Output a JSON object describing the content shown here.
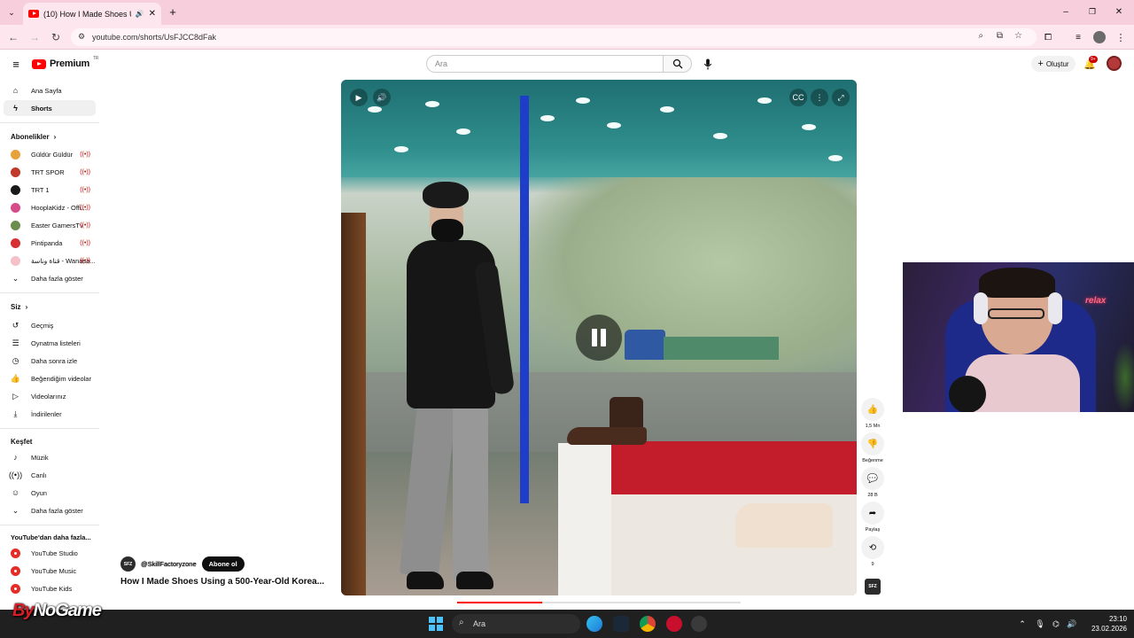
{
  "browser": {
    "tab_title": "(10) How I Made Shoes Usi",
    "url": "youtube.com/shorts/UsFJCC8dFak"
  },
  "header": {
    "logo_text": "Premium",
    "logo_region": "TR",
    "search_placeholder": "Ara",
    "create_label": "Oluştur",
    "notification_count": "9+"
  },
  "sidebar": {
    "main": [
      {
        "label": "Ana Sayfa",
        "icon": "home-icon"
      },
      {
        "label": "Shorts",
        "icon": "shorts-icon",
        "active": true
      }
    ],
    "subscriptions_header": "Abonelikler",
    "subscriptions": [
      {
        "label": "Güldür Güldür",
        "color": "#e8a23b",
        "live": true
      },
      {
        "label": "TRT SPOR",
        "color": "#c0392b",
        "live": true
      },
      {
        "label": "TRT 1",
        "color": "#1a1a1a",
        "live": true
      },
      {
        "label": "HooplaKidz - Offi...",
        "color": "#d64b8a",
        "live": true
      },
      {
        "label": "Easter GamersTv",
        "color": "#6b8e4e",
        "live": true
      },
      {
        "label": "Pintipanda",
        "color": "#d63031",
        "live": true
      },
      {
        "label": "قناة وناسة - Wanasa...",
        "color": "#f5c0c8",
        "live": true
      }
    ],
    "subscriptions_more": "Daha fazla göster",
    "you_header": "Siz",
    "you": [
      {
        "label": "Geçmiş",
        "icon": "history-icon"
      },
      {
        "label": "Oynatma listeleri",
        "icon": "playlist-icon"
      },
      {
        "label": "Daha sonra izle",
        "icon": "watch-later-icon"
      },
      {
        "label": "Beğendiğim videolar",
        "icon": "like-icon"
      },
      {
        "label": "Videolarınız",
        "icon": "your-videos-icon"
      },
      {
        "label": "İndirilenler",
        "icon": "download-icon"
      }
    ],
    "explore_header": "Keşfet",
    "explore": [
      {
        "label": "Müzik",
        "icon": "music-icon"
      },
      {
        "label": "Canlı",
        "icon": "live-icon"
      },
      {
        "label": "Oyun",
        "icon": "gaming-icon"
      }
    ],
    "explore_more": "Daha fazla göster",
    "more_header": "YouTube'dan daha fazla...",
    "more": [
      {
        "label": "YouTube Studio"
      },
      {
        "label": "YouTube Music"
      },
      {
        "label": "YouTube Kids"
      }
    ]
  },
  "short": {
    "channel_handle": "@SkillFactoryzone",
    "channel_avatar_text": "SFZ",
    "subscribe_label": "Abone ol",
    "title": "How I Made Shoes Using a 500-Year-Old Korea...",
    "likes": "1,5 Mn",
    "dislike_label": "Beğenme",
    "comments": "28 B",
    "share_label": "Paylaş",
    "remix_count": "9",
    "playback_progress": 0.3
  },
  "webcam": {
    "neon_sign": "relax"
  },
  "taskbar": {
    "search_placeholder": "Ara",
    "time": "23:10",
    "date": "23.02.2026"
  },
  "watermark": {
    "brand_a": "By",
    "brand_b": "NoGame"
  }
}
